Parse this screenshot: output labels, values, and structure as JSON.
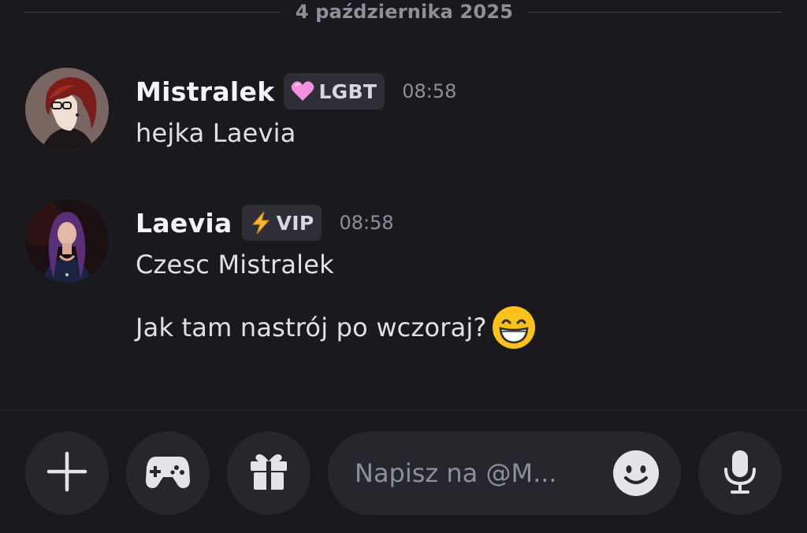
{
  "divider": {
    "date": "4 października 2025"
  },
  "messages": [
    {
      "author": "Mistralek",
      "badge": {
        "icon": "pink-heart-icon",
        "label": "LGBT"
      },
      "time": "08:58",
      "lines": [
        "hejka Laevia"
      ]
    },
    {
      "author": "Laevia",
      "badge": {
        "icon": "lightning-icon",
        "label": "VIP"
      },
      "time": "08:58",
      "lines": [
        "Czesc Mistralek",
        "Jak tam nastrój po wczoraj?"
      ],
      "trailing_emoji": "grinning-face-emoji"
    }
  ],
  "composer": {
    "placeholder": "Napisz na @M...",
    "value": "",
    "buttons": [
      "plus-icon",
      "gamepad-icon",
      "gift-icon",
      "emoji-icon",
      "microphone-icon"
    ]
  },
  "colors": {
    "background": "#1a1a1e",
    "surface": "#26272c",
    "badge_bg": "#2e2f36",
    "muted_text": "#8e9099",
    "heart": "#f58fe0",
    "lightning": "#f7b731"
  }
}
